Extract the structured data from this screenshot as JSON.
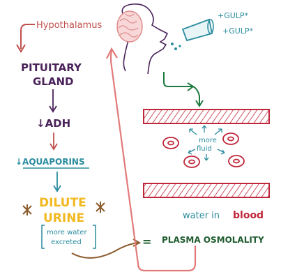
{
  "labels": {
    "hypothalamus": "Hypothalamus",
    "pituitary_line1": "PITUITARY",
    "pituitary_line2": "GLAND",
    "adh": "↓ADH",
    "aquaporins": "↓AQUAPORINS",
    "dilute_line1": "DILUTE",
    "dilute_line2": "URINE",
    "excreted_line1": "more water",
    "excreted_line2": "excreted",
    "gulp1": "+GULP*",
    "gulp2": "+GULP*",
    "more_fluid_line1": "more",
    "more_fluid_line2": "fluid",
    "water_in": "water in",
    "blood": "blood",
    "equals": "=",
    "plasma_osmolality": "PLASMA OSMOLALITY"
  },
  "colors": {
    "hypothalamus": "#c0504d",
    "pituitary": "#4a235a",
    "adh_arrow": "#c0504d",
    "adh": "#4a235a",
    "aquaporins": "#2a8c9e",
    "dilute": "#f2b820",
    "excreted": "#2a8c9e",
    "gulp": "#2a8c9e",
    "vessel": "#c0273a",
    "cells": "#c0273a",
    "more_fluid": "#2a8c9e",
    "water_in": "#2a8c9e",
    "blood": "#c0273a",
    "plasma": "#1f5c2f",
    "person": "#4a235a",
    "brain": "#e08a8a",
    "loop": "#e27a7a",
    "brown_arrow": "#8a5a2b",
    "green_arrow": "#1f7a3f"
  }
}
